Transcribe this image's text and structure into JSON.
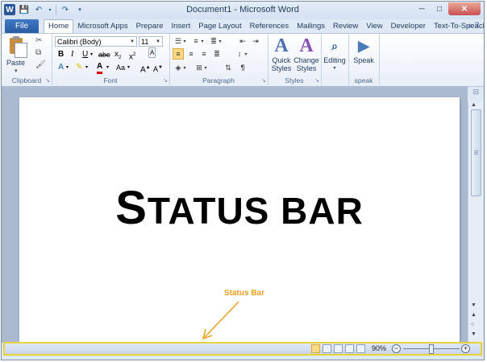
{
  "window": {
    "title": "Document1 - Microsoft Word"
  },
  "quick_access": {
    "app_icon": "W"
  },
  "tabs": {
    "file": "File",
    "items": [
      "Home",
      "Microsoft Apps",
      "Prepare",
      "Insert",
      "Page Layout",
      "References",
      "Mailings",
      "Review",
      "View",
      "Developer",
      "Text-To-Speach"
    ],
    "active": "Home"
  },
  "ribbon": {
    "clipboard": {
      "label": "Clipboard",
      "paste": "Paste"
    },
    "font": {
      "label": "Font",
      "font_name": "Calibri (Body)",
      "font_size": "11"
    },
    "paragraph": {
      "label": "Paragraph"
    },
    "styles": {
      "label": "Styles",
      "quick_styles": "Quick Styles",
      "change_styles": "Change Styles"
    },
    "editing": {
      "label": "",
      "editing": "Editing"
    },
    "speak": {
      "label": "speak",
      "speak": "Speak"
    }
  },
  "document": {
    "heading_first": "S",
    "heading_rest": "TATUS BAR",
    "annotation": "Status Bar"
  },
  "status_bar": {
    "zoom": "90%"
  },
  "colors": {
    "annotation": "#f0a020",
    "status_highlight": "#e8d23c",
    "file_tab": "#2a5ba3"
  }
}
